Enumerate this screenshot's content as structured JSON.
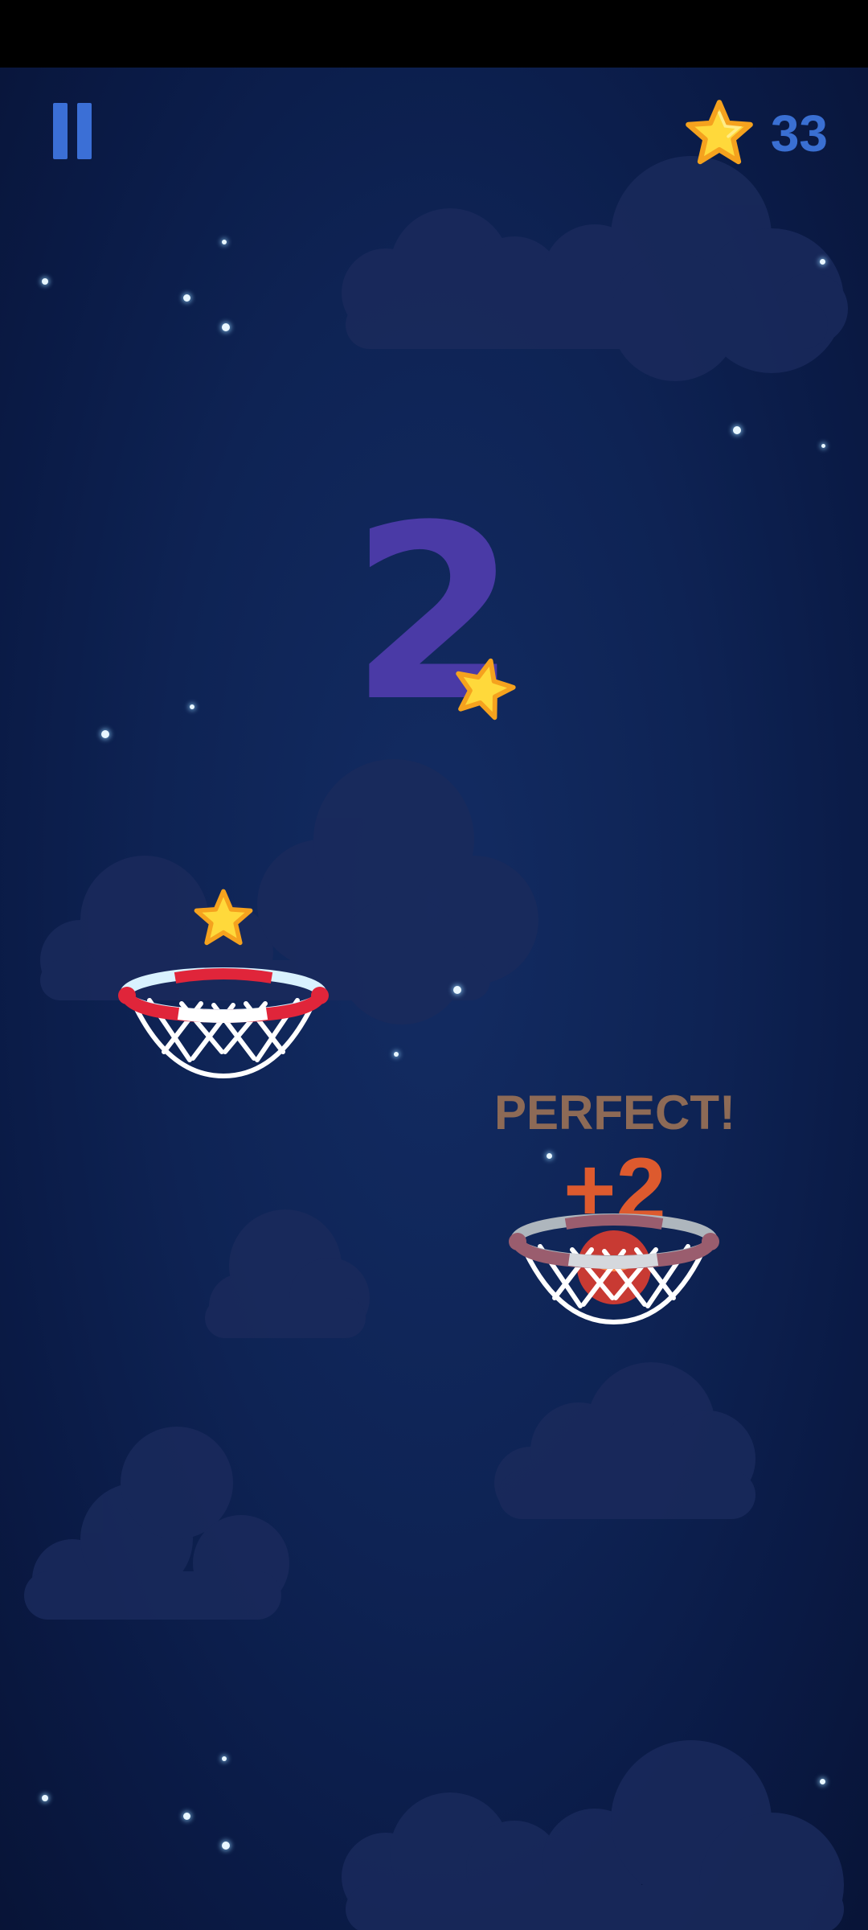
{
  "hud": {
    "pause_icon": "pause-icon",
    "coin_icon": "star-coin-icon",
    "coins": "33"
  },
  "game": {
    "score": "2",
    "feedback": "PERFECT!",
    "bonus": "+2"
  },
  "colors": {
    "background": "#0e2354",
    "score": "#4a3aa6",
    "hud_blue": "#3a6fd2",
    "star_yellow": "#ffd93b",
    "star_outline": "#f5a21e",
    "rim_red": "#e0253a",
    "perfect_text": "#8d6a56",
    "bonus_text": "#dd5a2e"
  }
}
